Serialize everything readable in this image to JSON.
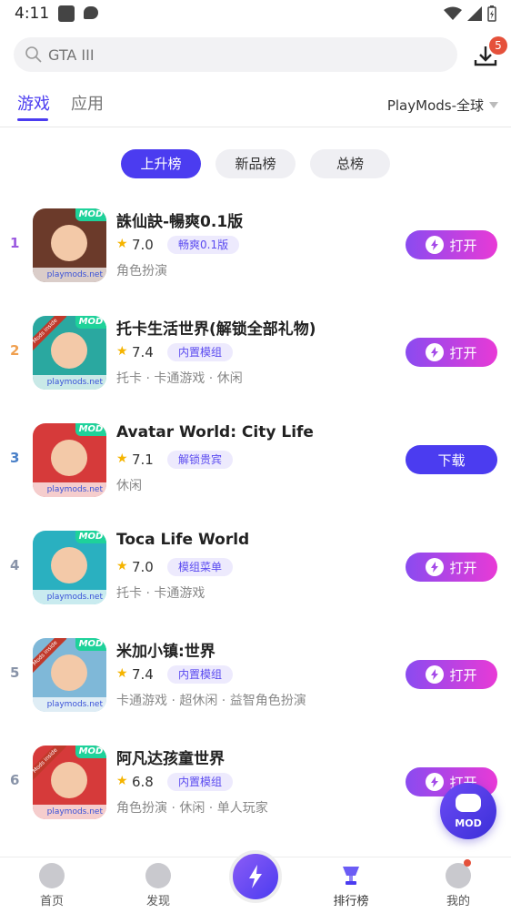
{
  "status": {
    "time": "4:11"
  },
  "search": {
    "placeholder": "GTA III"
  },
  "downloads": {
    "badge": "5"
  },
  "tabs": [
    {
      "label": "游戏"
    },
    {
      "label": "应用"
    }
  ],
  "region": {
    "label": "PlayMods-全球"
  },
  "filters": [
    {
      "label": "上升榜"
    },
    {
      "label": "新品榜"
    },
    {
      "label": "总榜"
    }
  ],
  "watermark": "playmods.net",
  "mod_label": "MOD",
  "ribbon_label": "Mods inside",
  "colors": {
    "accent": "#4b3cf0",
    "mod_green": "#1ed29a"
  },
  "apps": [
    {
      "rank": "1",
      "title": "誅仙訣-暢爽0.1版",
      "rating": "7.0",
      "tag": "畅爽0.1版",
      "cats": "角色扮演",
      "button": "打开",
      "rank_color": "#9b59e0",
      "icon_color": "#6b3a2a"
    },
    {
      "rank": "2",
      "title": "托卡生活世界(解锁全部礼物)",
      "rating": "7.4",
      "tag": "内置模组",
      "cats": "托卡 · 卡通游戏 · 休闲",
      "button": "打开",
      "rank_color": "#f0a050",
      "icon_color": "#2aa8a0"
    },
    {
      "rank": "3",
      "title": "Avatar World: City Life",
      "rating": "7.1",
      "tag": "解锁贵宾",
      "cats": "休闲",
      "button": "下载",
      "rank_color": "#4a80c8",
      "icon_color": "#d63a3a"
    },
    {
      "rank": "4",
      "title": "Toca Life World",
      "rating": "7.0",
      "tag": "模组菜单",
      "cats": "托卡 · 卡通游戏",
      "button": "打开",
      "rank_color": "#8893a8",
      "icon_color": "#2ab0c0"
    },
    {
      "rank": "5",
      "title": "米加小镇:世界",
      "rating": "7.4",
      "tag": "内置模组",
      "cats": "卡通游戏 · 超休闲 · 益智角色扮演",
      "button": "打开",
      "rank_color": "#8893a8",
      "icon_color": "#7fb8d8"
    },
    {
      "rank": "6",
      "title": "阿凡达孩童世界",
      "rating": "6.8",
      "tag": "内置模组",
      "cats": "角色扮演 · 休闲 · 单人玩家",
      "button": "打开",
      "rank_color": "#8893a8",
      "icon_color": "#d63a3a"
    }
  ],
  "fab": {
    "label": "MOD"
  },
  "nav": [
    {
      "label": "首页"
    },
    {
      "label": "发现"
    },
    {
      "label": "排行榜"
    },
    {
      "label": "我的"
    }
  ]
}
